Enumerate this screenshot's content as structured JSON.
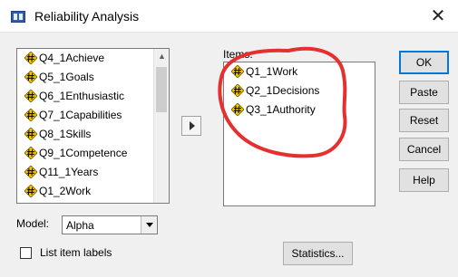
{
  "window": {
    "title": "Reliability Analysis",
    "close_glyph": "✕"
  },
  "source_list": {
    "items": [
      {
        "label": "Q4_1Achieve",
        "icon": "scale-variable-icon"
      },
      {
        "label": "Q5_1Goals",
        "icon": "scale-variable-icon"
      },
      {
        "label": "Q6_1Enthusiastic",
        "icon": "scale-variable-icon"
      },
      {
        "label": "Q7_1Capabilities",
        "icon": "scale-variable-icon"
      },
      {
        "label": "Q8_1Skills",
        "icon": "scale-variable-icon"
      },
      {
        "label": "Q9_1Competence",
        "icon": "scale-variable-icon"
      },
      {
        "label": "Q11_1Years",
        "icon": "scale-variable-icon"
      },
      {
        "label": "Q1_2Work",
        "icon": "scale-variable-icon"
      }
    ],
    "scroll_up_glyph": "▲"
  },
  "items_panel": {
    "label": "Items:",
    "items": [
      {
        "label": "Q1_1Work",
        "icon": "scale-variable-icon"
      },
      {
        "label": "Q2_1Decisions",
        "icon": "scale-variable-icon"
      },
      {
        "label": "Q3_1Authority",
        "icon": "scale-variable-icon"
      }
    ]
  },
  "buttons": {
    "ok": "OK",
    "paste": "Paste",
    "reset": "Reset",
    "cancel": "Cancel",
    "help": "Help",
    "statistics": "Statistics..."
  },
  "model": {
    "label": "Model:",
    "value": "Alpha"
  },
  "list_item_labels": {
    "label": "List item labels",
    "checked": false
  },
  "colors": {
    "annotation": "#e53030",
    "accent": "#0078d7",
    "icon_fill": "#f5c400"
  }
}
